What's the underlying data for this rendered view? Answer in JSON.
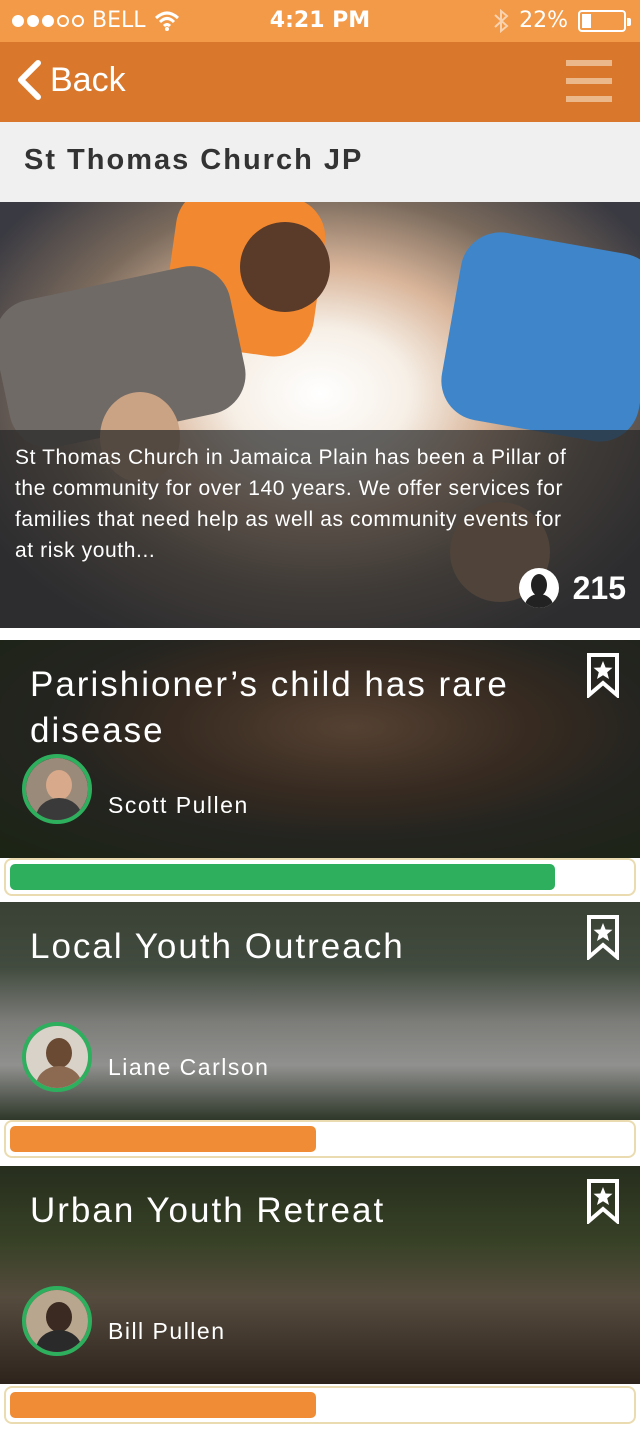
{
  "status_bar": {
    "carrier": "BELL",
    "time": "4:21 PM",
    "battery_text": "22%",
    "battery_level": 0.22
  },
  "nav": {
    "back_label": "Back",
    "menu_icon": "hamburger-menu-icon"
  },
  "page": {
    "title": "St Thomas Church JP"
  },
  "hero": {
    "description": "St Thomas Church in Jamaica Plain has been a Pillar of the community for over 140 years. We offer services for families that need help as well as community events for at risk youth...",
    "member_count": "215"
  },
  "cards": [
    {
      "title": "Parishioner’s child has rare disease",
      "author": "Scott Pullen",
      "progress": 0.88,
      "progress_color": "#2daf5e"
    },
    {
      "title": "Local Youth Outreach",
      "author": "Liane Carlson",
      "progress": 0.5,
      "progress_color": "#ef8c35"
    },
    {
      "title": "Urban Youth Retreat",
      "author": "Bill Pullen",
      "progress": 0.5,
      "progress_color": "#ef8c35"
    }
  ],
  "colors": {
    "status_bar": "#f39a48",
    "nav_bar": "#d9782c",
    "success_green": "#2daf5e",
    "accent_orange": "#ef8c35"
  }
}
